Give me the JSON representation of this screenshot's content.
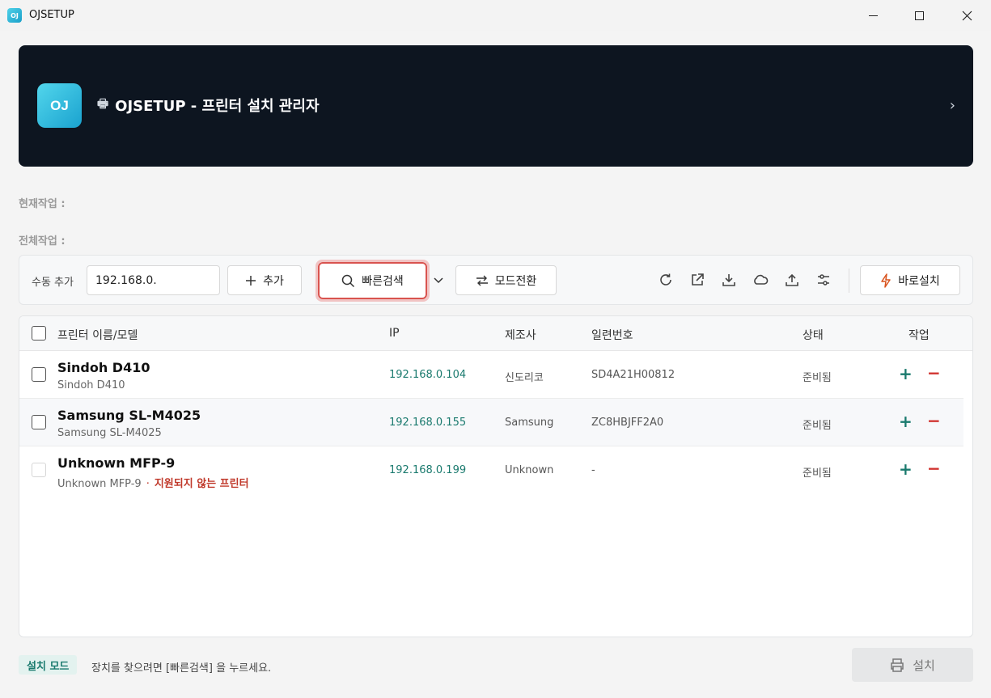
{
  "window": {
    "app_icon_text": "OJ",
    "title": "OJSETUP"
  },
  "banner": {
    "logo_text": "OJ",
    "title": "OJSETUP - 프린터 설치 관리자",
    "chevron": "›"
  },
  "status": {
    "current": "현재작업 :",
    "total": "전체작업 :"
  },
  "toolbar": {
    "manual_add_label": "수동 추가",
    "ip_value": "192.168.0.",
    "add_label": "추가",
    "quick_search_label": "빠른검색",
    "mode_switch_label": "모드전환",
    "instant_install_label": "바로설치",
    "icons": [
      "refresh-icon",
      "external-link-icon",
      "download-icon",
      "cloud-icon",
      "upload-icon",
      "settings-sliders-icon"
    ]
  },
  "table": {
    "headers": {
      "name": "프린터 이름/모델",
      "ip": "IP",
      "manufacturer": "제조사",
      "serial": "일련번호",
      "status": "상태",
      "action": "작업"
    },
    "rows": [
      {
        "name": "Sindoh D410",
        "model": "Sindoh D410",
        "ip": "192.168.0.104",
        "manufacturer": "신도리코",
        "serial": "SD4A21H00812",
        "status": "준비됨",
        "unsupported": ""
      },
      {
        "name": "Samsung SL-M4025",
        "model": "Samsung SL-M4025",
        "ip": "192.168.0.155",
        "manufacturer": "Samsung",
        "serial": "ZC8HBJFF2A0",
        "status": "준비됨",
        "unsupported": ""
      },
      {
        "name": "Unknown MFP-9",
        "model": "Unknown MFP-9",
        "ip": "192.168.0.199",
        "manufacturer": "Unknown",
        "serial": "-",
        "status": "준비됨",
        "separator": "·",
        "unsupported": "지원되지 않는 프린터"
      }
    ]
  },
  "footer": {
    "mode_badge": "설치 모드",
    "hint": "장치를 찾으려면 [빠른검색] 을 누르세요.",
    "install_label": "설치"
  },
  "colors": {
    "banner_bg": "#0d1520",
    "accent_teal": "#1a7a6e",
    "danger_red": "#d0312d",
    "highlight_border": "#d9534f"
  }
}
